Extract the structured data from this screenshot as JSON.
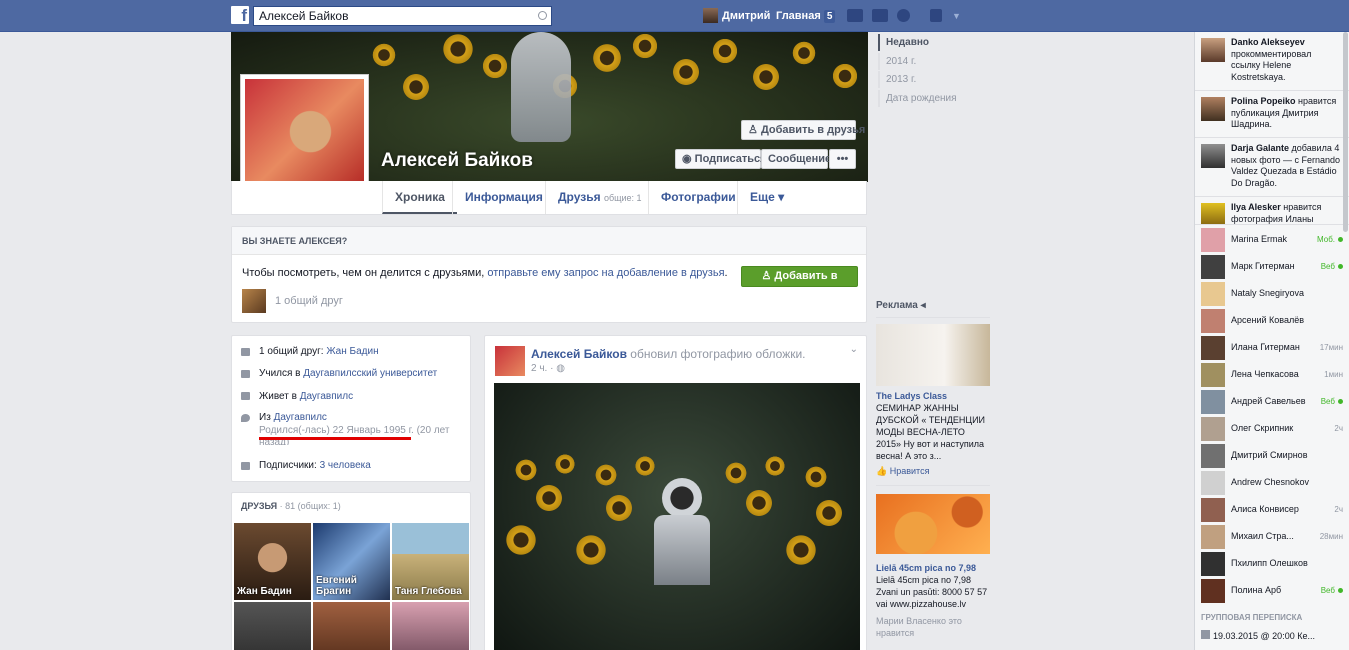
{
  "topbar": {
    "search_value": "Алексей Байков",
    "user_name": "Дмитрий",
    "home_label": "Главная",
    "home_badge": "5"
  },
  "profile": {
    "name": "Алексей Байков",
    "add_friend_cover": "Добавить в друзья",
    "subscribe": "Подписаться",
    "message": "Сообщение",
    "more_dots": "•••",
    "tabs": [
      {
        "label": "Хроника"
      },
      {
        "label": "Информация"
      },
      {
        "label": "Друзья",
        "sub": "общие: 1"
      },
      {
        "label": "Фотографии"
      },
      {
        "label": "Еще ▾"
      }
    ]
  },
  "know": {
    "header": "ВЫ ЗНАЕТЕ АЛЕКСЕЯ?",
    "text": "Чтобы посмотреть, чем он делится с друзьями,",
    "link": "отправьте ему запрос на добавление в друзья",
    "dot": ".",
    "button": "Добавить в друзья",
    "mutual": "1 общий друг"
  },
  "intro": {
    "rows": [
      {
        "pre": "1 общий друг:",
        "link": "Жан Бадин"
      },
      {
        "pre": "Учился в",
        "link": "Даугавпилсский университет"
      },
      {
        "pre": "Живет в",
        "link": "Даугавпилс"
      },
      {
        "pre": "Из",
        "link": "Даугавпилс"
      },
      {
        "pre": "Подписчики:",
        "link": "3 человека"
      }
    ],
    "born_line1": "Родился(-лась) 22 Январь 1995 г. (20 лет",
    "born_line2": "назад)"
  },
  "friends": {
    "header": "ДРУЗЬЯ",
    "count": "· 81 (общих: 1)",
    "items": [
      {
        "name": "Жан Бадин"
      },
      {
        "name": "Евгений Брагин"
      },
      {
        "name": "Таня Глебова"
      }
    ]
  },
  "post": {
    "author": "Алексей Байков",
    "action": "обновил фотографию обложки.",
    "time": "2 ч. ·"
  },
  "timeline": [
    "Недавно",
    "2014 г.",
    "2013 г.",
    "Дата рождения"
  ],
  "ads": {
    "header": "Реклама",
    "ad1": {
      "title": "The Ladys Class",
      "text": "СЕМИНАР ЖАННЫ ДУБСКОЙ « ТЕНДЕНЦИИ МОДЫ ВЕСНА-ЛЕТО 2015» Ну вот и наступила весна! А это з...",
      "like": "Нравится"
    },
    "ad2": {
      "title": "Lielā 45cm pica no 7,98",
      "text": "Lielā 45cm pica no 7,98 Zvani un pasūti: 8000 57 57 vai www.pizzahouse.lv",
      "social": "Марии Власенко это нравится"
    }
  },
  "ticker": [
    {
      "name": "Danko Alekseyev",
      "text": "прокомментировал ссылку Helene Kostretskaya."
    },
    {
      "name": "Polina Popeiko",
      "text": "нравится публикация Дмитрия Шадрина."
    },
    {
      "name": "Darja Galante",
      "text": "добавила 4 новых фото — с Fernando Valdez Quezada в Estádio Do Dragão."
    },
    {
      "name": "Ilya Alesker",
      "text": "нравится фотография Иланы"
    }
  ],
  "chat": [
    {
      "name": "Marina Ermak",
      "status": "Моб.",
      "online": true
    },
    {
      "name": "Марк Гитерман",
      "status": "Веб",
      "online": true
    },
    {
      "name": "Nataly Snegiryova",
      "status": "",
      "online": false
    },
    {
      "name": "Арсений Ковалёв",
      "status": "",
      "online": false
    },
    {
      "name": "Илана Гитерман",
      "status": "17мин",
      "online": false
    },
    {
      "name": "Лена Чепкасова",
      "status": "1мин",
      "online": false
    },
    {
      "name": "Андрей Савельев",
      "status": "Веб",
      "online": true
    },
    {
      "name": "Олег Скрипник",
      "status": "2ч",
      "online": false
    },
    {
      "name": "Дмитрий Смирнов",
      "status": "",
      "online": false
    },
    {
      "name": "Andrew Chesnokov",
      "status": "",
      "online": false
    },
    {
      "name": "Алиса Конвисер",
      "status": "2ч",
      "online": false
    },
    {
      "name": "Михаил Стра...",
      "status": "28мин",
      "online": false
    },
    {
      "name": "Пхилипп Олешков",
      "status": "",
      "online": false
    },
    {
      "name": "Полина Арб",
      "status": "Веб",
      "online": true
    }
  ],
  "group_chat": {
    "header": "ГРУППОВАЯ ПЕРЕПИСКА",
    "item": "19.03.2015 @ 20:00 Ке..."
  },
  "colors": {
    "topbar": "#4e69a2",
    "link": "#3b5998",
    "green_button": "#5b9e2b",
    "annotation_underline": "#e00000"
  }
}
